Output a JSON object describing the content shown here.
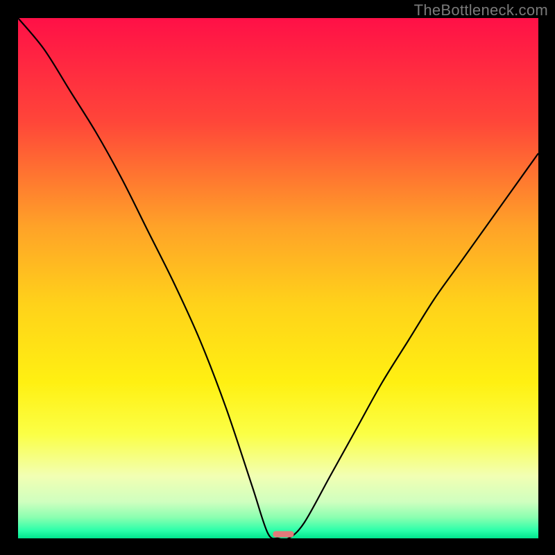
{
  "watermark": "TheBottleneck.com",
  "chart_data": {
    "type": "line",
    "title": "",
    "xlabel": "",
    "ylabel": "",
    "xlim": [
      0,
      100
    ],
    "ylim": [
      0,
      100
    ],
    "x": [
      0,
      5,
      10,
      15,
      20,
      25,
      30,
      35,
      40,
      45,
      48,
      50,
      52,
      55,
      60,
      65,
      70,
      75,
      80,
      85,
      90,
      95,
      100
    ],
    "values": [
      100,
      94,
      86,
      78,
      69,
      59,
      49,
      38,
      25,
      10,
      1,
      0,
      0,
      3,
      12,
      21,
      30,
      38,
      46,
      53,
      60,
      67,
      74
    ],
    "min_x": 50,
    "background": {
      "type": "vertical-gradient",
      "stops": [
        {
          "offset": 0.0,
          "color": "#ff1047"
        },
        {
          "offset": 0.2,
          "color": "#ff4639"
        },
        {
          "offset": 0.4,
          "color": "#ffa228"
        },
        {
          "offset": 0.55,
          "color": "#ffd21a"
        },
        {
          "offset": 0.7,
          "color": "#fff012"
        },
        {
          "offset": 0.8,
          "color": "#fbff46"
        },
        {
          "offset": 0.88,
          "color": "#f2ffb3"
        },
        {
          "offset": 0.93,
          "color": "#cfffbf"
        },
        {
          "offset": 0.96,
          "color": "#8affb0"
        },
        {
          "offset": 0.985,
          "color": "#2bffaa"
        },
        {
          "offset": 1.0,
          "color": "#00e58e"
        }
      ]
    },
    "marker": {
      "x": 51,
      "y": 0.8,
      "width": 4,
      "height": 1.2,
      "color": "#e17a7a"
    },
    "curve_color": "#000000",
    "curve_width": 2.2
  }
}
